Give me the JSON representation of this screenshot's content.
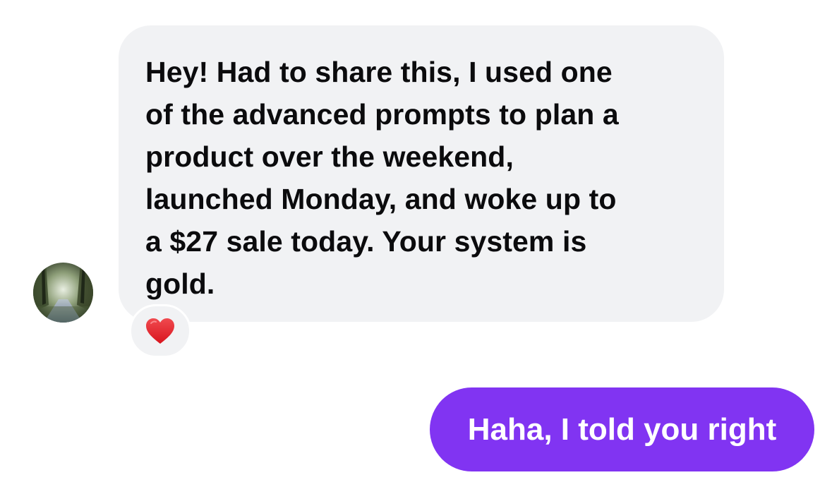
{
  "conversation": {
    "incoming_message": {
      "text": "Hey! Had to share this, I used one\nof the advanced prompts to plan a\nproduct over the weekend,\nlaunched Monday, and woke up to\na $27 sale today. Your system is\ngold.",
      "bubble_color": "#f1f2f4",
      "avatar": "contact-avatar-forest-path",
      "reaction": {
        "icon": "red-heart-icon",
        "color": "#e0242b"
      }
    },
    "outgoing_message": {
      "text": "Haha, I told you right",
      "bubble_color": "#8134f2",
      "text_color": "#ffffff"
    }
  }
}
